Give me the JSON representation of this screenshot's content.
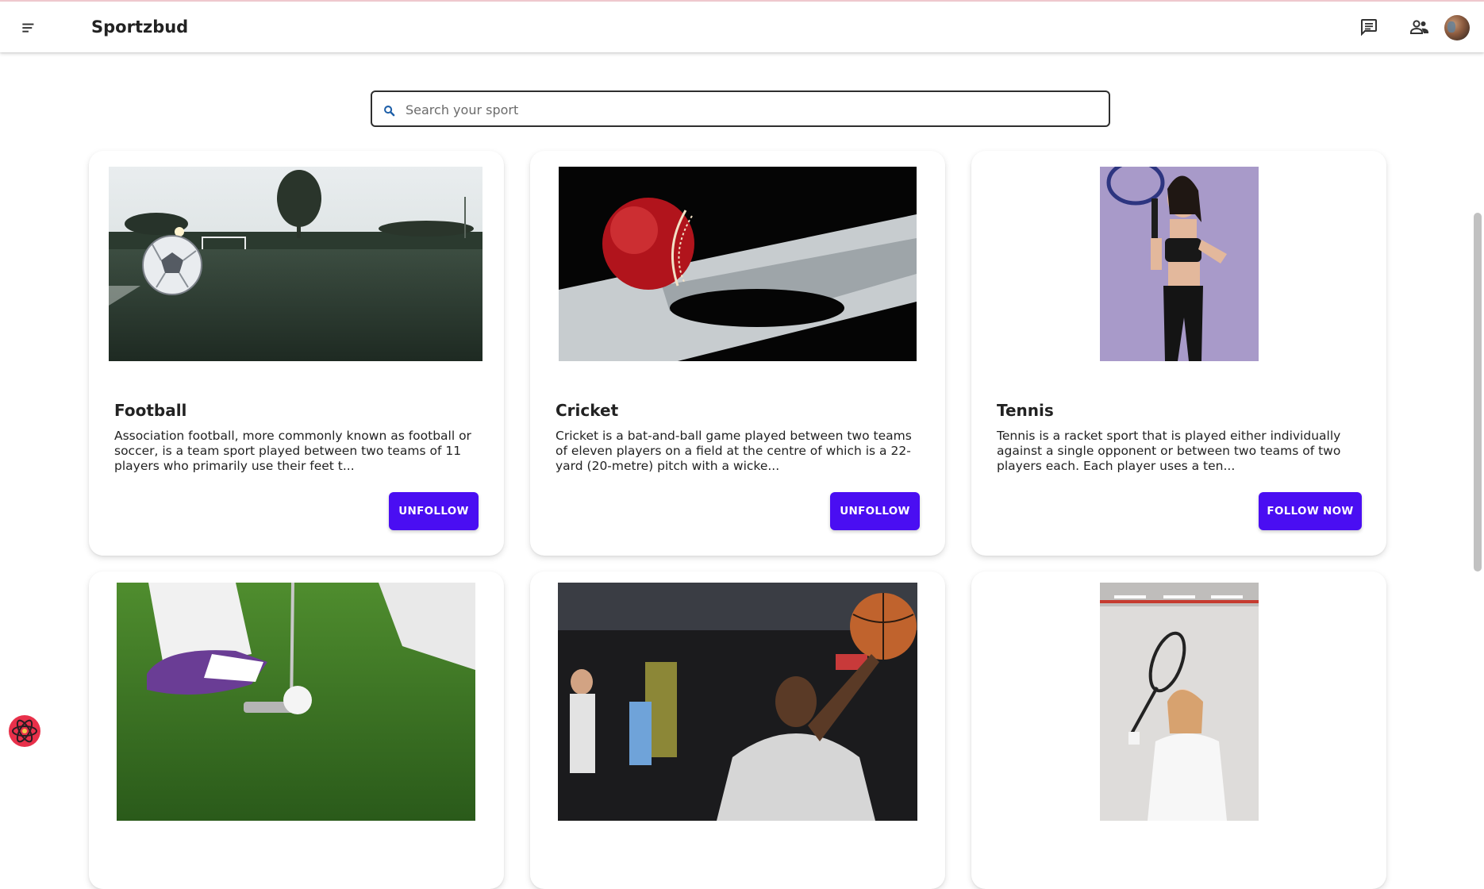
{
  "app": {
    "title": "Sportzbud"
  },
  "header": {
    "menu_icon": "menu-icon",
    "chat_icon": "chat-icon",
    "people_icon": "people-icon",
    "avatar": "user-avatar"
  },
  "search": {
    "placeholder": "Search your sport",
    "icon": "search-icon"
  },
  "sports": [
    {
      "title": "Football",
      "description": "Association football, more commonly known as football or soccer, is a team sport played between two teams of 11 players who primarily use their feet t...",
      "button": "UNFOLLOW"
    },
    {
      "title": "Cricket",
      "description": "Cricket is a bat-and-ball game played between two teams of eleven players on a field at the centre of which is a 22-yard (20-metre) pitch with a wicke...",
      "button": "UNFOLLOW"
    },
    {
      "title": "Tennis",
      "description": "Tennis is a racket sport that is played either individually against a single opponent or between two teams of two players each. Each player uses a ten...",
      "button": "FOLLOW NOW"
    },
    {
      "image": "golf-photo"
    },
    {
      "image": "basketball-photo"
    },
    {
      "image": "badminton-photo"
    }
  ],
  "colors": {
    "accent": "#4a0ef2",
    "card_bg": "#ffffff"
  }
}
